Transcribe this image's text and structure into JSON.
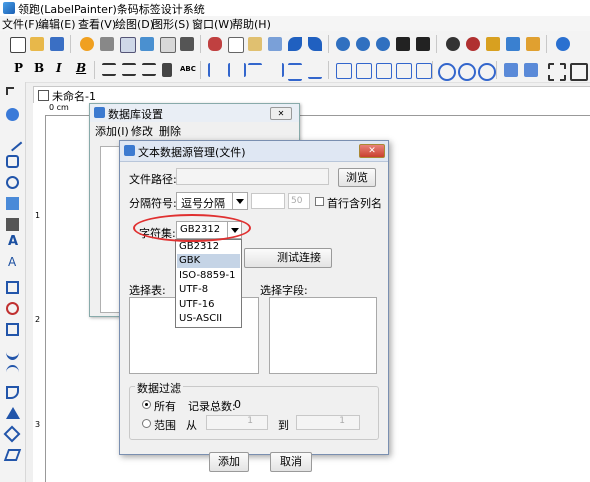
{
  "app": {
    "title": "领跑(LabelPainter)条码标签设计系统"
  },
  "menu": [
    "文件(F)",
    "编辑(E)",
    "查看(V)",
    "绘图(D)",
    "图形(S)",
    "窗口(W)",
    "帮助(H)"
  ],
  "format_toolbar": {
    "bold": "B",
    "italic": "I",
    "abc": "ABC"
  },
  "document": {
    "tab": "未命名-1",
    "ruler_unit": "0 cm",
    "ruler_marks": [
      "1",
      "2",
      "3"
    ]
  },
  "db_window": {
    "title": "数据库设置",
    "menu": [
      "添加(I)",
      "修改",
      "删除"
    ]
  },
  "dialog": {
    "title": "文本数据源管理(文件)",
    "close": "✕",
    "file_path_label": "文件路径:",
    "file_path_value": "",
    "browse_button": "浏览",
    "separator_label": "分隔符号:",
    "separator_value": "逗号分隔",
    "separator_custom": "",
    "separator_code": "50",
    "first_row_header": "首行含列名",
    "charset_label": "字符集:",
    "charset_value": "GB2312",
    "charset_options": [
      "GB2312",
      "GBK",
      "ISO-8859-1",
      "UTF-8",
      "UTF-16",
      "US-ASCII"
    ],
    "charset_highlighted": "GBK",
    "test_connection": "测试连接",
    "select_table_label": "选择表:",
    "select_field_label": "选择字段:",
    "filter": {
      "title": "数据过滤",
      "all_label": "所有",
      "record_total_label": "记录总数:",
      "record_total_value": "0",
      "range_label": "范围",
      "from_label": "从",
      "to_label": "到",
      "from_value": "1",
      "to_value": "1"
    },
    "add_button": "添加",
    "cancel_button": "取消"
  },
  "colors": {
    "accent": "#e03030",
    "selection": "#c5d4e6",
    "caption": "#dfe7f3"
  }
}
